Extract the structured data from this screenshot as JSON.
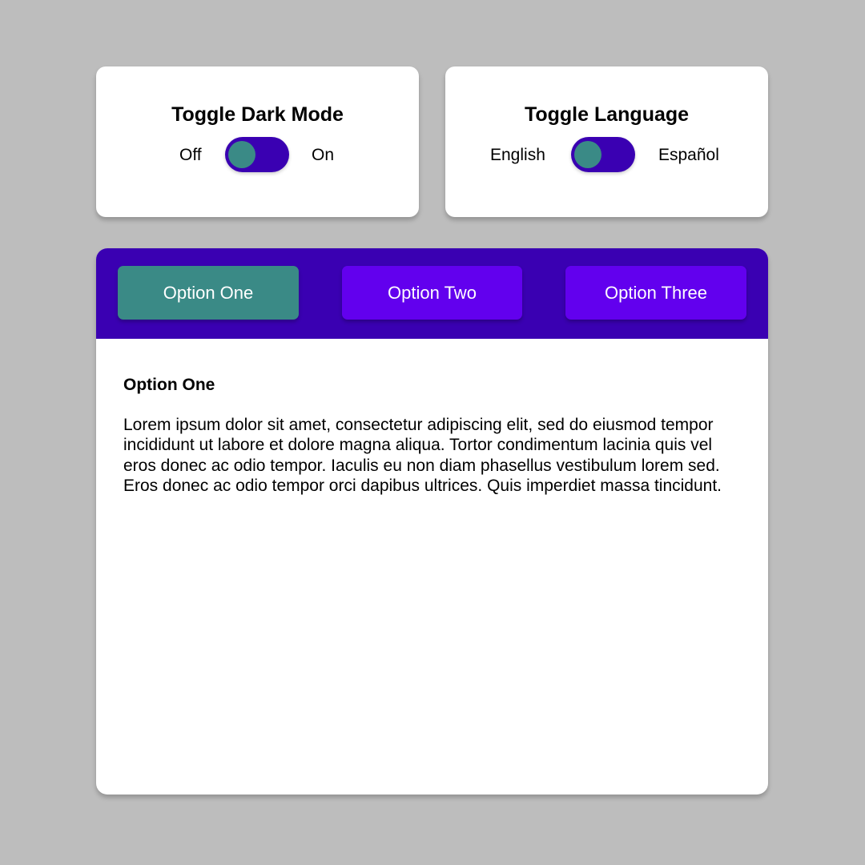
{
  "dark_mode_toggle": {
    "title": "Toggle Dark Mode",
    "off_label": "Off",
    "on_label": "On",
    "state": "off"
  },
  "language_toggle": {
    "title": "Toggle Language",
    "left_label": "English",
    "right_label": "Español",
    "state": "English"
  },
  "tabs": {
    "items": [
      {
        "label": "Option One",
        "active": true
      },
      {
        "label": "Option Two",
        "active": false
      },
      {
        "label": "Option Three",
        "active": false
      }
    ]
  },
  "content": {
    "title": "Option One",
    "body": "Lorem ipsum dolor sit amet, consectetur adipiscing elit, sed do eiusmod tempor incididunt ut labore et dolore magna aliqua. Tortor condimentum lacinia quis vel eros donec ac odio tempor. Iaculis eu non diam phasellus vestibulum lorem sed. Eros donec ac odio tempor orci dapibus ultrices. Quis imperdiet massa tincidunt."
  },
  "colors": {
    "background": "#bdbdbd",
    "card": "#ffffff",
    "primary_dark": "#3a00b2",
    "primary": "#6200ee",
    "accent_teal": "#3a8a86",
    "text": "#000000"
  }
}
